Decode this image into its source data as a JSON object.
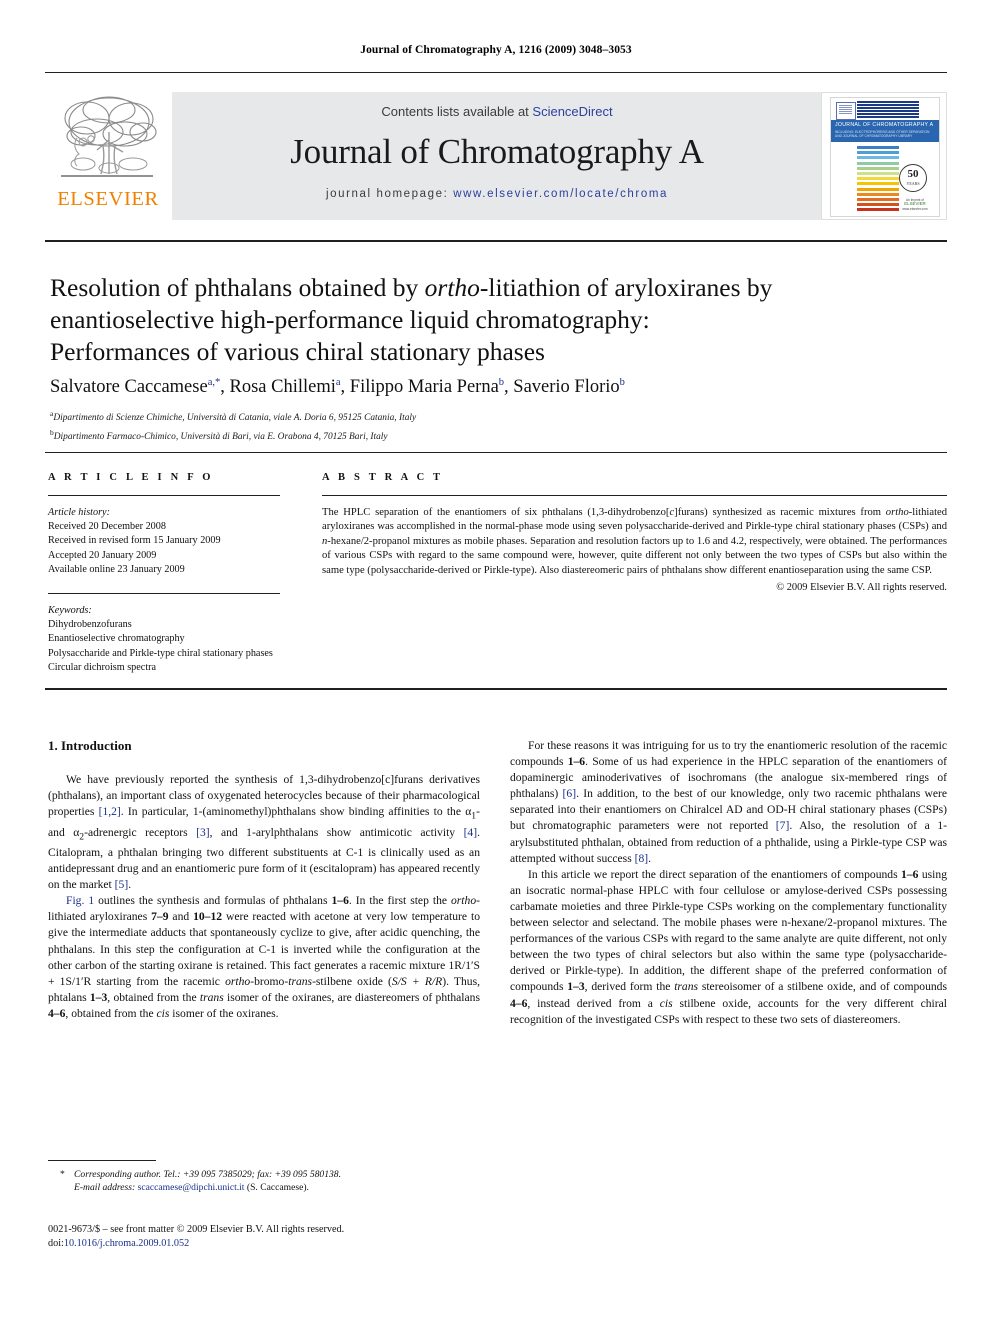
{
  "running_head": "Journal of Chromatography A, 1216 (2009) 3048–3053",
  "masthead": {
    "contents_prefix": "Contents lists available at ",
    "sciencedirect": "ScienceDirect",
    "journal_name": "Journal of Chromatography A",
    "homepage_prefix": "journal homepage: ",
    "homepage_url": "www.elsevier.com/locate/chroma",
    "publisher_logo_text": "ELSEVIER",
    "link_color": "#2b3f9e",
    "elsevier_orange": "#F08000"
  },
  "cover": {
    "band_title": "JOURNAL OF CHROMATOGRAPHY A",
    "band_sub_line1": "INCLUDING: ELECTROPHORESIS AND OTHER SEPARATION",
    "band_sub_line2": "AND JOURNAL OF CHROMATOGRAPHY LIBRARY",
    "seal_number": "50",
    "seal_label": "YEARS",
    "credit_line1": "An imprint of",
    "credit_line2": "ELSEVIER",
    "credit_line3": "www.elsevier.com",
    "stripe_colors": [
      "#3b7fc4",
      "#4f9fd4",
      "#6fb7de",
      "#8ec9a8",
      "#a8d08a",
      "#cfe08a",
      "#f2d93a",
      "#f6c400",
      "#f0a500",
      "#ea8a1e",
      "#e06c20",
      "#d6511f",
      "#c8321b"
    ]
  },
  "article": {
    "title_line1_a": "Resolution of phthalans obtained by ",
    "title_line1_i": "ortho",
    "title_line1_b": "-litiathion of aryloxiranes by",
    "title_line2": "enantioselective high-performance liquid chromatography:",
    "title_line3": "Performances of various chiral stationary phases",
    "authors": [
      {
        "name": "Salvatore Caccamese",
        "marks": "a,*"
      },
      {
        "name": "Rosa Chillemi",
        "marks": "a"
      },
      {
        "name": "Filippo Maria Perna",
        "marks": "b"
      },
      {
        "name": "Saverio Florio",
        "marks": "b"
      }
    ],
    "affiliations": [
      {
        "mark": "a",
        "text": "Dipartimento di Scienze Chimiche, Università di Catania, viale A. Doria 6, 95125 Catania, Italy"
      },
      {
        "mark": "b",
        "text": "Dipartimento Farmaco-Chimico, Università di Bari, via E. Orabona 4, 70125 Bari, Italy"
      }
    ]
  },
  "info": {
    "heading": "A R T I C L E   I N F O",
    "history_label": "Article history:",
    "history": [
      "Received 20 December 2008",
      "Received in revised form 15 January 2009",
      "Accepted 20 January 2009",
      "Available online 23 January 2009"
    ],
    "keywords_label": "Keywords:",
    "keywords": [
      "Dihydrobenzofurans",
      "Enantioselective chromatography",
      "Polysaccharide and Pirkle-type chiral stationary phases",
      "Circular dichroism spectra"
    ]
  },
  "abstract": {
    "heading": "A B S T R A C T",
    "p1_a": "The HPLC separation of the enantiomers of six phthalans (1,3-dihydrobenzo[",
    "p1_i1": "c",
    "p1_b": "]furans) synthesized as racemic mixtures from ",
    "p1_i2": "ortho",
    "p1_c": "-lithiated aryloxiranes was accomplished in the normal-phase mode using seven polysaccharide-derived and Pirkle-type chiral stationary phases (CSPs) and ",
    "p1_i3": "n",
    "p1_d": "-hexane/2-propanol mixtures as mobile phases. Separation and resolution factors up to 1.6 and 4.2, respectively, were obtained. The performances of various CSPs with regard to the same compound were, however, quite different not only between the two types of CSPs but also within the same type (polysaccharide-derived or Pirkle-type). Also diastereomeric pairs of phthalans show different enantioseparation using the same CSP.",
    "copyright": "© 2009 Elsevier B.V. All rights reserved."
  },
  "body": {
    "section_heading": "1.  Introduction",
    "left": {
      "p1_a": "We have previously reported the synthesis of 1,3-dihydrobenzo[c]furans derivatives (phthalans), an important class of oxygenated heterocycles because of their pharmacological properties ",
      "p1_r1": "[1,2]",
      "p1_b": ". In particular, 1-(aminomethyl)phthalans show binding affinities to the α",
      "p1_sub1": "1",
      "p1_c": "- and α",
      "p1_sub2": "2",
      "p1_d": "-adrenergic receptors ",
      "p1_r2": "[3]",
      "p1_e": ", and 1-arylphthalans show antimicotic activity ",
      "p1_r3": "[4]",
      "p1_f": ". Citalopram, a phthalan bringing two different substituents at C-1 is clinically used as an antidepressant drug and an enantiomeric pure form of it (escitalopram) has appeared recently on the market ",
      "p1_r4": "[5]",
      "p1_g": ".",
      "p2_a": "Fig. 1",
      "p2_b": " outlines the synthesis and formulas of phthalans ",
      "p2_bold1": "1–6",
      "p2_c": ". In the first step the ",
      "p2_i1": "ortho",
      "p2_d": "-lithiated aryloxiranes ",
      "p2_bold2": "7–9",
      "p2_e": " and ",
      "p2_bold3": "10–12",
      "p2_f": " were reacted with acetone at very low temperature to give the intermediate adducts that spontaneously cyclize to give, after acidic quenching, the phthalans. In this step the configuration at C-1 is inverted while the configuration at the other carbon of the starting oxirane is retained. This fact generates a racemic mixture 1R/1′S + 1S/1′R starting from the racemic ",
      "p2_i2": "ortho",
      "p2_g": "-bromo-",
      "p2_i3": "trans",
      "p2_h": "-stilbene oxide (",
      "p2_i4": "S/S + R/R",
      "p2_j": "). Thus, phtalans ",
      "p2_bold4": "1–3",
      "p2_k": ", obtained from the ",
      "p2_i5": "trans",
      "p2_l": " isomer of the oxiranes, are diastereomers of phthalans ",
      "p2_bold5": "4–6",
      "p2_m": ", obtained from the ",
      "p2_i6": "cis",
      "p2_n": " isomer of the oxiranes."
    },
    "right": {
      "p1_a": "For these reasons it was intriguing for us to try the enantiomeric resolution of the racemic compounds ",
      "p1_bold1": "1–6",
      "p1_b": ". Some of us had experience in the HPLC separation of the enantiomers of dopaminergic aminoderivatives of isochromans (the analogue six-membered rings of phthalans) ",
      "p1_r1": "[6]",
      "p1_c": ". In addition, to the best of our knowledge, only two racemic phthalans were separated into their enantiomers on Chiralcel AD and OD-H chiral stationary phases (CSPs) but chromatographic parameters were not reported ",
      "p1_r2": "[7]",
      "p1_d": ". Also, the resolution of a 1-arylsubstituted phthalan, obtained from reduction of a phthalide, using a Pirkle-type CSP was attempted without success ",
      "p1_r3": "[8]",
      "p1_e": ".",
      "p2_a": "In this article we report the direct separation of the enantiomers of compounds ",
      "p2_bold1": "1–6",
      "p2_b": " using an isocratic normal-phase HPLC with four cellulose or amylose-derived CSPs possessing carbamate moieties and three Pirkle-type CSPs working on the complementary functionality between selector and selectand. The mobile phases were n-hexane/2-propanol mixtures. The performances of the various CSPs with regard to the same analyte are quite different, not only between the two types of chiral selectors but also within the same type (polysaccharide-derived or Pirkle-type). In addition, the different shape of the preferred conformation of compounds ",
      "p2_bold2": "1–3",
      "p2_c": ", derived form the ",
      "p2_i1": "trans",
      "p2_d": " stereoisomer of a stilbene oxide, and of compounds ",
      "p2_bold3": "4–6",
      "p2_e": ", instead derived from a ",
      "p2_i2": "cis",
      "p2_f": " stilbene oxide, accounts for the very different chiral recognition of the investigated CSPs with respect to these two sets of diastereomers."
    }
  },
  "footnote": {
    "star": "*",
    "corresponding": "Corresponding author. Tel.: +39 095 7385029; fax: +39 095 580138.",
    "email_label": "E-mail address:",
    "email": "scaccamese@dipchi.unict.it",
    "email_suffix": " (S. Caccamese)."
  },
  "imprint": {
    "line1": "0021-9673/$ – see front matter © 2009 Elsevier B.V. All rights reserved.",
    "doi_label": "doi:",
    "doi": "10.1016/j.chroma.2009.01.052"
  }
}
